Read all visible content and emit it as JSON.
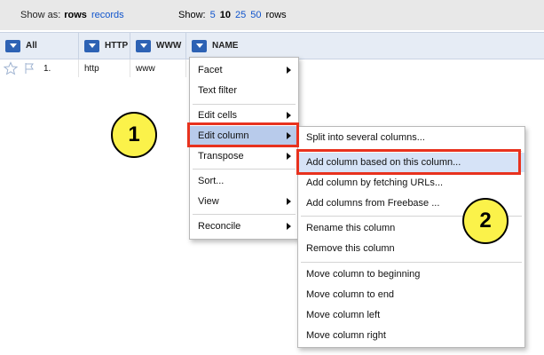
{
  "view_bar": {
    "show_as_label": "Show as:",
    "rows_option": "rows",
    "records_option": "records",
    "show_label": "Show:",
    "page_sizes": [
      "5",
      "10",
      "25",
      "50"
    ],
    "selected_page_size": "10",
    "rows_suffix": "rows"
  },
  "columns": [
    {
      "name": "All"
    },
    {
      "name": "HTTP"
    },
    {
      "name": "WWW"
    },
    {
      "name": "NAME"
    }
  ],
  "row": {
    "index": "1.",
    "http": "http",
    "www": "www"
  },
  "column_menu": {
    "items": [
      {
        "label": "Facet",
        "submenu": true
      },
      {
        "label": "Text filter",
        "submenu": false
      },
      {
        "label": "Edit cells",
        "submenu": true
      },
      {
        "label": "Edit column",
        "submenu": true
      },
      {
        "label": "Transpose",
        "submenu": true
      },
      {
        "label": "Sort...",
        "submenu": false
      },
      {
        "label": "View",
        "submenu": true
      },
      {
        "label": "Reconcile",
        "submenu": true
      }
    ]
  },
  "edit_column_submenu": {
    "items": [
      {
        "label": "Split into several columns..."
      },
      {
        "label": "Add column based on this column..."
      },
      {
        "label": "Add column by fetching URLs..."
      },
      {
        "label": "Add columns from Freebase ..."
      },
      {
        "label": "Rename this column"
      },
      {
        "label": "Remove this column"
      },
      {
        "label": "Move column to beginning"
      },
      {
        "label": "Move column to end"
      },
      {
        "label": "Move column left"
      },
      {
        "label": "Move column right"
      }
    ]
  },
  "callouts": [
    "1",
    "2"
  ],
  "colors": {
    "header_bg": "#e6ecf5",
    "dropdown_button": "#2d62b4",
    "menu_active": "#b8cbeb",
    "highlight_box": "#e8321e",
    "callout_fill": "#fbf24a",
    "link": "#1155cc"
  }
}
